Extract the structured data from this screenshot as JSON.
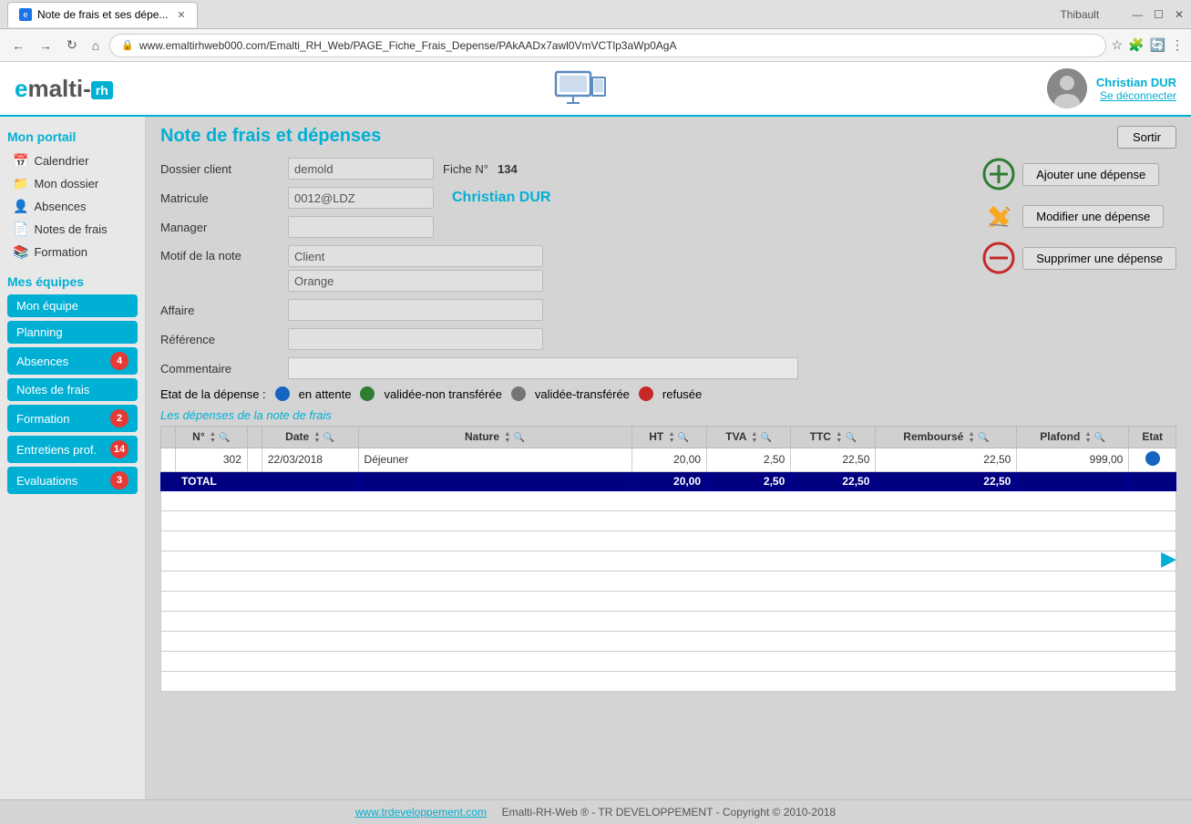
{
  "browser": {
    "tab_title": "Note de frais et ses dépe...",
    "tab_icon": "e",
    "url": "www.emaltirhweb000.com/Emalti_RH_Web/PAGE_Fiche_Frais_Depense/PAkAADx7awl0VmVCTlp3aWp0AgA",
    "user_label": "Thibault",
    "window_controls": [
      "—",
      "☐",
      "✕"
    ]
  },
  "app": {
    "logo": "emalti-rh",
    "user_name": "Christian DUR",
    "logout_label": "Se déconnecter"
  },
  "sidebar": {
    "mon_portail_label": "Mon portail",
    "items": [
      {
        "id": "calendrier",
        "label": "Calendrier",
        "icon": "📅"
      },
      {
        "id": "mon-dossier",
        "label": "Mon dossier",
        "icon": "📁"
      },
      {
        "id": "absences",
        "label": "Absences",
        "icon": "👤"
      },
      {
        "id": "notes-de-frais",
        "label": "Notes de frais",
        "icon": "📄"
      },
      {
        "id": "formation",
        "label": "Formation",
        "icon": "📚"
      }
    ],
    "mes_equipes_label": "Mes équipes",
    "team_buttons": [
      {
        "id": "mon-equipe",
        "label": "Mon équipe",
        "badge": null
      },
      {
        "id": "planning",
        "label": "Planning",
        "badge": null
      },
      {
        "id": "absences-team",
        "label": "Absences",
        "badge": 4
      },
      {
        "id": "notes-de-frais-team",
        "label": "Notes de frais",
        "badge": null
      },
      {
        "id": "formation-team",
        "label": "Formation",
        "badge": 2
      },
      {
        "id": "entretiens-prof",
        "label": "Entretiens prof.",
        "badge": 14
      },
      {
        "id": "evaluations",
        "label": "Evaluations",
        "badge": 3
      }
    ]
  },
  "page": {
    "title": "Note de frais et dépenses",
    "sortir_label": "Sortir",
    "form": {
      "dossier_label": "Dossier client",
      "dossier_value": "demold",
      "fiche_label": "Fiche N°",
      "fiche_value": "134",
      "matricule_label": "Matricule",
      "matricule_value": "0012@LDZ",
      "matricule_name": "Christian DUR",
      "manager_label": "Manager",
      "manager_value": "",
      "motif_label": "Motif de la note",
      "motif_value1": "Client",
      "motif_value2": "Orange",
      "affaire_label": "Affaire",
      "affaire_value": "",
      "reference_label": "Référence",
      "reference_value": "",
      "commentaire_label": "Commentaire",
      "commentaire_value": ""
    },
    "actions": {
      "ajouter": "Ajouter une dépense",
      "modifier": "Modifier une dépense",
      "supprimer": "Supprimer une dépense"
    },
    "etat_label": "Etat de la dépense :",
    "etat_items": [
      {
        "id": "en-attente",
        "color": "blue",
        "label": "en attente"
      },
      {
        "id": "validee-non-transferee",
        "color": "green",
        "label": "validée-non transférée"
      },
      {
        "id": "validee-transferee",
        "color": "gray",
        "label": "validée-transférée"
      },
      {
        "id": "refusee",
        "color": "red",
        "label": "refusée"
      }
    ],
    "table": {
      "section_title": "Les dépenses de la note de frais",
      "columns": [
        "N°",
        "Date",
        "Nature",
        "HT",
        "TVA",
        "TTC",
        "Remboursé",
        "Plafond",
        "Etat"
      ],
      "rows": [
        {
          "num": "302",
          "date": "22/03/2018",
          "nature": "Déjeuner",
          "ht": "20,00",
          "tva": "2,50",
          "ttc": "22,50",
          "rembourse": "22,50",
          "plafond": "999,00",
          "etat": "blue"
        }
      ],
      "total_row": {
        "label": "TOTAL",
        "ht": "20,00",
        "tva": "2,50",
        "ttc": "22,50",
        "rembourse": "22,50"
      }
    }
  },
  "footer": {
    "link": "www.trdeveloppement.com",
    "text": "Emalti-RH-Web ® - TR DEVELOPPEMENT - Copyright © 2010-2018"
  }
}
